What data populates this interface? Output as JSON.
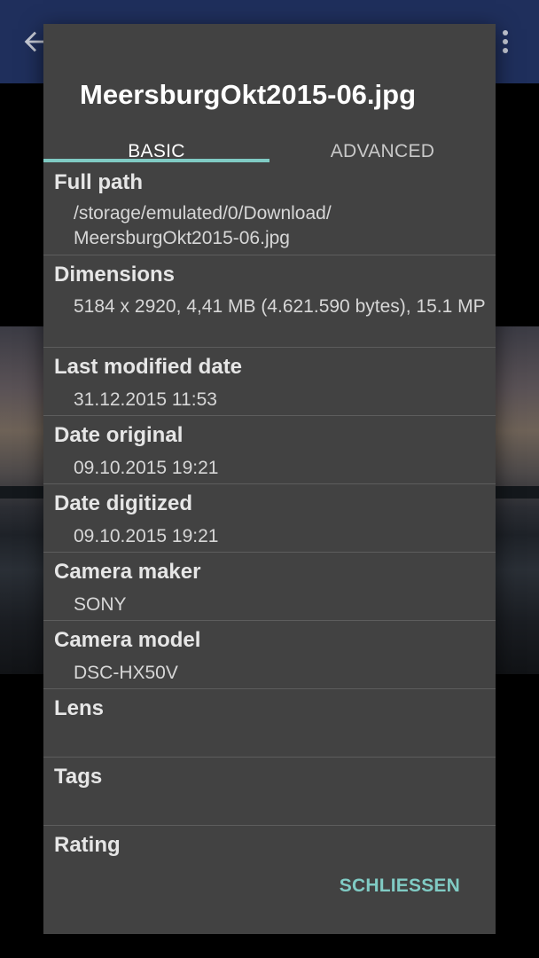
{
  "dialog": {
    "title": "MeersburgOkt2015-06.jpg",
    "tabs": [
      {
        "label": "BASIC",
        "selected": true
      },
      {
        "label": "ADVANCED",
        "selected": false
      }
    ],
    "rows": [
      {
        "label": "Full path",
        "value": "/storage/emulated/0/Download/ MeersburgOkt2015-06.jpg"
      },
      {
        "label": "Dimensions",
        "value": "5184 x 2920, 4,41 MB (4.621.590 bytes), 15.1 MP"
      },
      {
        "label": "Last modified date",
        "value": "31.12.2015 11:53"
      },
      {
        "label": "Date original",
        "value": "09.10.2015 19:21"
      },
      {
        "label": "Date digitized",
        "value": "09.10.2015 19:21"
      },
      {
        "label": "Camera maker",
        "value": "SONY"
      },
      {
        "label": "Camera model",
        "value": "DSC-HX50V"
      },
      {
        "label": "Lens",
        "value": ""
      },
      {
        "label": "Tags",
        "value": ""
      },
      {
        "label": "Rating",
        "value": ""
      }
    ],
    "close_label": "SCHLIESSEN"
  },
  "background": {
    "icons": [
      "back-arrow-icon",
      "more-vert-icon"
    ]
  },
  "colors": {
    "accent": "#80cbc4",
    "dialog_bg": "#424242",
    "appbar_bg": "#1f2f5c"
  }
}
